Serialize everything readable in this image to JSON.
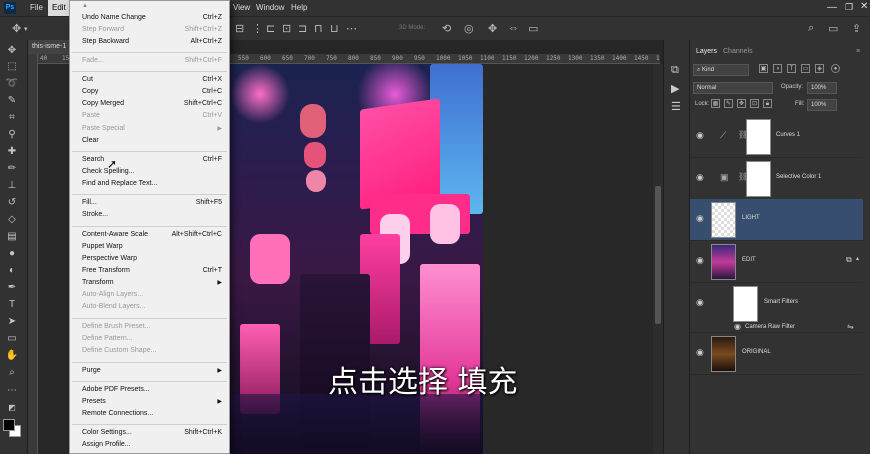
{
  "menubar": {
    "logo": "Ps",
    "items": [
      "File",
      "Edit",
      "View",
      "Window",
      "Help"
    ]
  },
  "document": {
    "tab_title": "this-isme-1"
  },
  "ruler": {
    "h_ticks": [
      "40",
      "150",
      "200",
      "250",
      "300",
      "350",
      "400",
      "450",
      "500",
      "550",
      "600",
      "650",
      "700",
      "750",
      "800",
      "850",
      "900",
      "950",
      "1000",
      "1050",
      "1100",
      "1150",
      "1200",
      "1250",
      "1300",
      "1350",
      "1400",
      "1450",
      "150"
    ]
  },
  "optbar": {
    "mode_3d": "3D Mode:"
  },
  "caption": "点击选择 填充",
  "edit_menu": {
    "items": [
      {
        "label": "Undo Name Change",
        "shortcut": "Ctrl+Z",
        "disabled": false
      },
      {
        "label": "Step Forward",
        "shortcut": "Shift+Ctrl+Z",
        "disabled": true
      },
      {
        "label": "Step Backward",
        "shortcut": "Alt+Ctrl+Z",
        "disabled": false
      },
      {
        "label": "Fade...",
        "shortcut": "Shift+Ctrl+F",
        "disabled": true
      },
      {
        "label": "Cut",
        "shortcut": "Ctrl+X",
        "disabled": false
      },
      {
        "label": "Copy",
        "shortcut": "Ctrl+C",
        "disabled": false
      },
      {
        "label": "Copy Merged",
        "shortcut": "Shift+Ctrl+C",
        "disabled": false
      },
      {
        "label": "Paste",
        "shortcut": "Ctrl+V",
        "disabled": true
      },
      {
        "label": "Paste Special",
        "shortcut": "",
        "submenu": true,
        "disabled": true
      },
      {
        "label": "Clear",
        "shortcut": "",
        "disabled": false
      },
      {
        "label": "Search",
        "shortcut": "Ctrl+F",
        "disabled": false
      },
      {
        "label": "Check Spelling...",
        "shortcut": "",
        "disabled": false
      },
      {
        "label": "Find and Replace Text...",
        "shortcut": "",
        "disabled": false
      },
      {
        "label": "Fill...",
        "shortcut": "Shift+F5",
        "disabled": false
      },
      {
        "label": "Stroke...",
        "shortcut": "",
        "disabled": false
      },
      {
        "label": "Content-Aware Scale",
        "shortcut": "Alt+Shift+Ctrl+C",
        "disabled": false
      },
      {
        "label": "Puppet Warp",
        "shortcut": "",
        "disabled": false
      },
      {
        "label": "Perspective Warp",
        "shortcut": "",
        "disabled": false
      },
      {
        "label": "Free Transform",
        "shortcut": "Ctrl+T",
        "disabled": false
      },
      {
        "label": "Transform",
        "shortcut": "",
        "submenu": true,
        "disabled": false
      },
      {
        "label": "Auto-Align Layers...",
        "shortcut": "",
        "disabled": true
      },
      {
        "label": "Auto-Blend Layers...",
        "shortcut": "",
        "disabled": true
      },
      {
        "label": "Define Brush Preset...",
        "shortcut": "",
        "disabled": true
      },
      {
        "label": "Define Pattern...",
        "shortcut": "",
        "disabled": true
      },
      {
        "label": "Define Custom Shape...",
        "shortcut": "",
        "disabled": true
      },
      {
        "label": "Purge",
        "shortcut": "",
        "submenu": true,
        "disabled": false
      },
      {
        "label": "Adobe PDF Presets...",
        "shortcut": "",
        "disabled": false
      },
      {
        "label": "Presets",
        "shortcut": "",
        "submenu": true,
        "disabled": false
      },
      {
        "label": "Remote Connections...",
        "shortcut": "",
        "disabled": false
      },
      {
        "label": "Color Settings...",
        "shortcut": "Shift+Ctrl+K",
        "disabled": false
      },
      {
        "label": "Assign Profile...",
        "shortcut": "",
        "disabled": false
      }
    ]
  },
  "layers_panel": {
    "tabs": [
      "Layers",
      "Channels"
    ],
    "filter_kind": "Kind",
    "blend_mode": "Normal",
    "opacity_label": "Opacity:",
    "opacity_value": "100%",
    "lock_label": "Lock:",
    "fill_label": "Fill:",
    "fill_value": "100%",
    "layers": [
      {
        "name": "Curves 1",
        "selected": false
      },
      {
        "name": "Selective Color 1",
        "selected": false
      },
      {
        "name": "LIGHT",
        "selected": true
      },
      {
        "name": "EDIT",
        "selected": false
      },
      {
        "name": "Smart Filters",
        "selected": false
      },
      {
        "name": "Camera Raw Filter",
        "selected": false
      },
      {
        "name": "ORIGINAL",
        "selected": false
      }
    ]
  }
}
